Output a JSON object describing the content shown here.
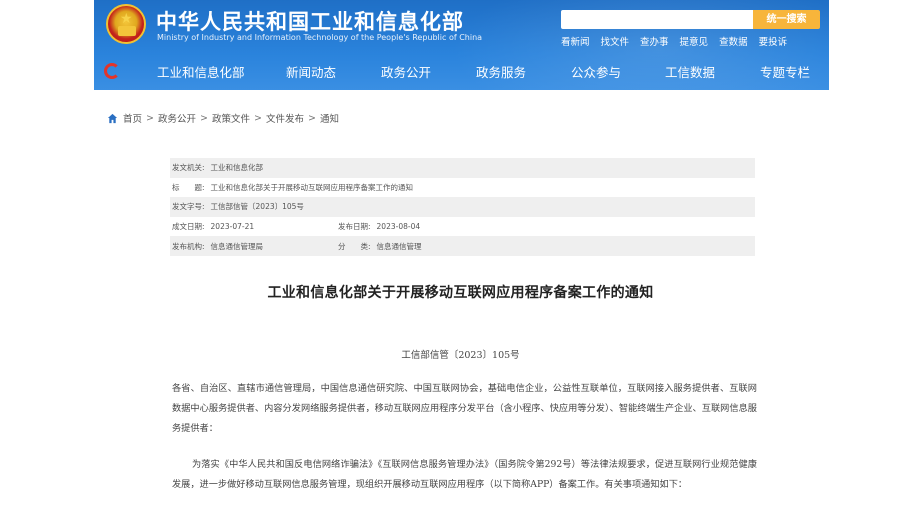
{
  "header": {
    "site_title": "中华人民共和国工业和信息化部",
    "site_subtitle": "Ministry of Industry and Information Technology of the People's Republic of China",
    "search_placeholder": "",
    "search_button": "统一搜索",
    "quick_links": [
      "看新闻",
      "找文件",
      "查办事",
      "提意见",
      "查数据",
      "要投诉"
    ],
    "nav": [
      "工业和信息化部",
      "新闻动态",
      "政务公开",
      "政务服务",
      "公众参与",
      "工信数据",
      "专题专栏"
    ]
  },
  "breadcrumb": {
    "items": [
      "首页",
      "政务公开",
      "政策文件",
      "文件发布",
      "通知"
    ],
    "separator": ">"
  },
  "meta": {
    "issuer_label": "发文机关:",
    "issuer_value": "工业和信息化部",
    "title_label": "标　　题:",
    "title_value": "工业和信息化部关于开展移动互联网应用程序备案工作的通知",
    "doc_no_label": "发文字号:",
    "doc_no_value": "工信部信管〔2023〕105号",
    "created_label": "成文日期:",
    "created_value": "2023-07-21",
    "published_label": "发布日期:",
    "published_value": "2023-08-04",
    "agency_label": "发布机构:",
    "agency_value": "信息通信管理局",
    "category_label": "分　　类:",
    "category_value": "信息通信管理"
  },
  "document": {
    "title": "工业和信息化部关于开展移动互联网应用程序备案工作的通知",
    "number": "工信部信管〔2023〕105号",
    "paragraph_1": "各省、自治区、直辖市通信管理局，中国信息通信研究院、中国互联网协会，基础电信企业，公益性互联单位，互联网接入服务提供者、互联网数据中心服务提供者、内容分发网络服务提供者，移动互联网应用程序分发平台（含小程序、快应用等分发）、智能终端生产企业、互联网信息服务提供者：",
    "paragraph_2": "为落实《中华人民共和国反电信网络诈骗法》《互联网信息服务管理办法》（国务院令第292号）等法律法规要求，促进互联网行业规范健康发展，进一步做好移动互联网信息服务管理，现组织开展移动互联网应用程序（以下简称APP）备案工作。有关事项通知如下："
  },
  "colors": {
    "header_blue": "#2a83dc",
    "search_orange": "#f7b53b",
    "emblem_red": "#c3221c"
  }
}
